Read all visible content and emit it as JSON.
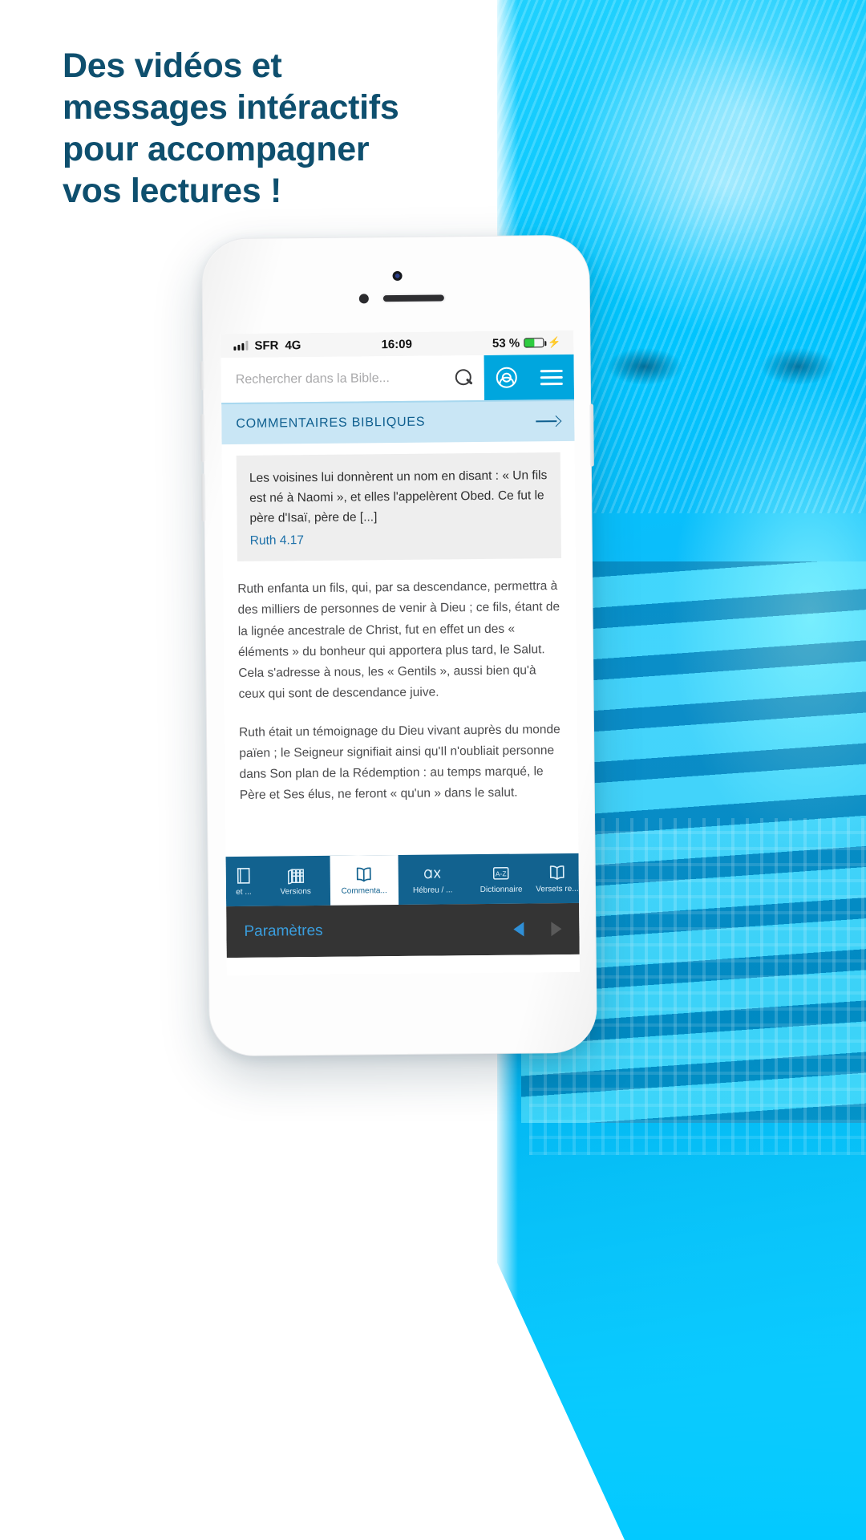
{
  "headline": {
    "lines": [
      "Des vidéos et",
      "messages intéractifs",
      "pour accompagner",
      "vos lectures !"
    ],
    "color": "#0e4f6e"
  },
  "phone": {
    "status_bar": {
      "carrier": "SFR",
      "network": "4G",
      "time": "16:09",
      "battery_percent": "53 %",
      "charging_icon": "bolt-icon",
      "signal_icon": "signal-bars-icon",
      "battery_icon": "battery-icon"
    },
    "search": {
      "placeholder": "Rechercher dans la Bible...",
      "value": "",
      "search_icon": "search-icon",
      "account_icon": "user-circle-icon",
      "menu_icon": "hamburger-menu-icon",
      "accent": "#00a6de"
    },
    "section_banner": {
      "label": "COMMENTAIRES BIBLIQUES",
      "arrow_icon": "arrow-right-icon",
      "background": "#c9e6f5",
      "text_color": "#0f5f8f"
    },
    "verse_card": {
      "text": "Les voisines lui donnèrent un nom en disant : « Un fils est né à Naomi », et elles l'appelèrent Obed. Ce fut le père d'Isaï, père de [...]",
      "reference": "Ruth 4.17",
      "reference_color": "#1b6fa8",
      "background": "#eeeeee"
    },
    "commentary": {
      "paragraph_1": "Ruth enfanta un fils, qui, par sa descendance, permettra à des milliers de personnes de venir à Dieu ; ce fils, étant de la lignée ancestrale de Christ, fut en effet un des « éléments » du bonheur qui apportera plus tard, le Salut. Cela s'adresse à nous, les « Gentils », aussi bien qu'à ceux qui sont de descendance juive.",
      "paragraph_2": "Ruth était un témoignage du Dieu vivant auprès du monde païen ; le Seigneur signifiait ainsi qu'Il n'oubliait personne dans Son plan de la Rédemption : au temps marqué, le Père et Ses élus, ne feront « qu'un » dans le salut."
    },
    "tabbar": {
      "background": "#12628f",
      "active_background": "#ffffff",
      "tabs": [
        {
          "label": "et ...",
          "icon": "book-icon",
          "active": false,
          "partial": true
        },
        {
          "label": "Versions",
          "icon": "books-shelf-icon",
          "active": false,
          "partial": false
        },
        {
          "label": "Commenta...",
          "icon": "open-book-icon",
          "active": true,
          "partial": false
        },
        {
          "label": "Hébreu / ...",
          "icon": "hebrew-greek-icon",
          "active": false,
          "partial": false
        },
        {
          "label": "Dictionnaire",
          "icon": "a-z-dictionary-icon",
          "active": false,
          "partial": false
        },
        {
          "label": "Versets re...",
          "icon": "open-book-icon",
          "active": false,
          "partial": true
        }
      ]
    },
    "settings_bar": {
      "label": "Paramètres",
      "label_color": "#3a9ede",
      "background": "#343434",
      "prev_icon": "triangle-left-icon",
      "next_icon": "triangle-right-icon"
    }
  }
}
